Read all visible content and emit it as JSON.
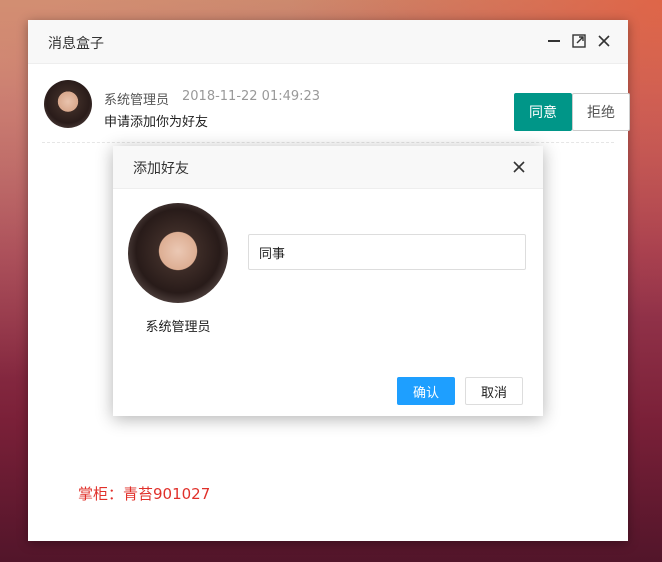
{
  "window": {
    "title": "消息盒子",
    "controls": [
      "minimize-icon",
      "maximize-icon",
      "close-icon"
    ]
  },
  "message": {
    "sender": "系统管理员",
    "time": "2018-11-22 01:49:23",
    "text": "申请添加你为好友",
    "agree_label": "同意",
    "refuse_label": "拒绝"
  },
  "footer": {
    "text": "掌柜：青苔901027"
  },
  "dialog": {
    "title": "添加好友",
    "user_name": "系统管理员",
    "remark_value": "同事",
    "ok_label": "确认",
    "cancel_label": "取消"
  },
  "colors": {
    "agree": "#009688",
    "ok": "#1e9fff",
    "footer_text": "#e0302a"
  }
}
